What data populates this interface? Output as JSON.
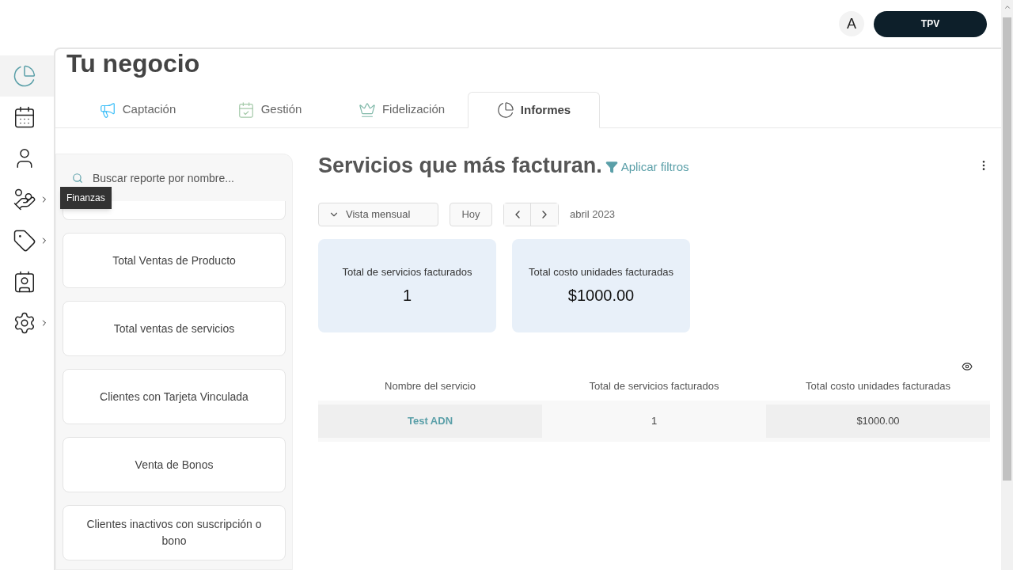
{
  "header": {
    "avatar": "A",
    "tpv_button": "TPV"
  },
  "sidebar": {
    "items": [
      {
        "kind": "pie",
        "selected": true,
        "has_submenu": false
      },
      {
        "kind": "calendar",
        "selected": false,
        "has_submenu": false
      },
      {
        "kind": "person",
        "selected": false,
        "has_submenu": false
      },
      {
        "kind": "money",
        "selected": false,
        "has_submenu": true,
        "tooltip": "Finanzas"
      },
      {
        "kind": "tag",
        "selected": false,
        "has_submenu": true
      },
      {
        "kind": "badge",
        "selected": false,
        "has_submenu": false
      },
      {
        "kind": "gear",
        "selected": false,
        "has_submenu": true
      }
    ]
  },
  "page_title": "Tu negocio",
  "tabs": [
    {
      "label": "Captación",
      "kind": "megaphone",
      "selected": false
    },
    {
      "label": "Gestión",
      "kind": "calendar",
      "selected": false
    },
    {
      "label": "Fidelización",
      "kind": "crown",
      "selected": false
    },
    {
      "label": "Informes",
      "kind": "pie",
      "selected": true
    }
  ],
  "report_search": {
    "placeholder": "Buscar reporte por nombre..."
  },
  "reports": [
    "Total Ventas de Producto",
    "Total ventas de servicios",
    "Clientes con Tarjeta Vinculada",
    "Venta de Bonos",
    "Clientes inactivos con suscripción o bono"
  ],
  "report": {
    "title": "Servicios que más facturan.",
    "filter_link": "Aplicar filtros",
    "view_select": "Vista mensual",
    "today_button": "Hoy",
    "period": "abril 2023",
    "stats": [
      {
        "label": "Total de servicios facturados",
        "value": "1"
      },
      {
        "label": "Total costo unidades facturadas",
        "value": "$1000.00"
      }
    ],
    "table": {
      "columns": [
        "Nombre del servicio",
        "Total de servicios facturados",
        "Total costo unidades facturadas"
      ],
      "rows": [
        [
          "Test ADN",
          "1",
          "$1000.00"
        ]
      ]
    }
  }
}
